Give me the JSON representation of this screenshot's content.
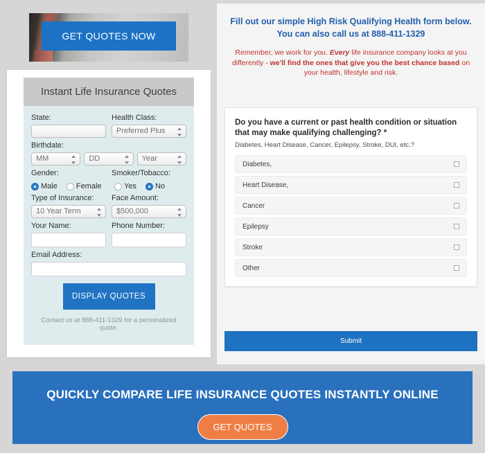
{
  "hero": {
    "cta_label": "GET QUOTES NOW"
  },
  "quote_form": {
    "header_title": "Instant Life Insurance Quotes",
    "labels": {
      "state": "State:",
      "health_class": "Health Class:",
      "birthdate": "Birthdate:",
      "gender": "Gender:",
      "smoker": "Smoker/Tobacco:",
      "type_of_insurance": "Type of Insurance:",
      "face_amount": "Face Amount:",
      "your_name": "Your Name:",
      "phone_number": "Phone Number:",
      "email_address": "Email Address:"
    },
    "values": {
      "state": "",
      "health_class": "Preferred Plus",
      "birth_month": "MM",
      "birth_day": "DD",
      "birth_year": "Year",
      "type_of_insurance": "10 Year Term",
      "face_amount": "$500,000",
      "your_name": "",
      "phone_number": "",
      "email_address": ""
    },
    "gender_options": [
      {
        "label": "Male",
        "selected": true
      },
      {
        "label": "Female",
        "selected": false
      }
    ],
    "smoker_options": [
      {
        "label": "Yes",
        "selected": false
      },
      {
        "label": "No",
        "selected": true
      }
    ],
    "submit_label": "DISPLAY QUOTES",
    "contact_note": "Contact us at 888-411-1329 for a personalized quote."
  },
  "right_panel": {
    "headline_line1": "Fill out our simple High Risk Qualifying Health form below.",
    "headline_line2_prefix": "You can also call us at ",
    "headline_phone": "888-411-1329",
    "subhead_part1": "Remember, we work for you. ",
    "subhead_every": "Every",
    "subhead_part2": " life insurance company looks at you differently - ",
    "subhead_bold1": "we'll find the ones that give you the best chance based",
    "subhead_part3": " on your health, lifestyle and risk.",
    "question_title": "Do you have a current or past health condition or situation that may make qualifying challenging? *",
    "question_sub": "Diabetes, Heart Disease, Cancer, Epilepsy, Stroke, DUI, etc.?",
    "conditions": [
      {
        "label": "Diabetes,",
        "checked": false
      },
      {
        "label": "Heart Disease,",
        "checked": false
      },
      {
        "label": "Cancer",
        "checked": false
      },
      {
        "label": "Epilepsy",
        "checked": false
      },
      {
        "label": "Stroke",
        "checked": false
      },
      {
        "label": "Other",
        "checked": false
      }
    ],
    "submit_label": "Submit"
  },
  "bottom_banner": {
    "title": "QUICKLY COMPARE LIFE INSURANCE QUOTES INSTANTLY ONLINE",
    "button_label": "GET QUOTES"
  },
  "colors": {
    "brand_blue": "#2a71bd",
    "cta_blue": "#1c72c4",
    "accent_orange": "#ef7e45",
    "headline_blue": "#2460ad",
    "warning_red": "#c1322f",
    "form_body_mint": "#dfeced",
    "page_gray": "#d6d6d6"
  }
}
